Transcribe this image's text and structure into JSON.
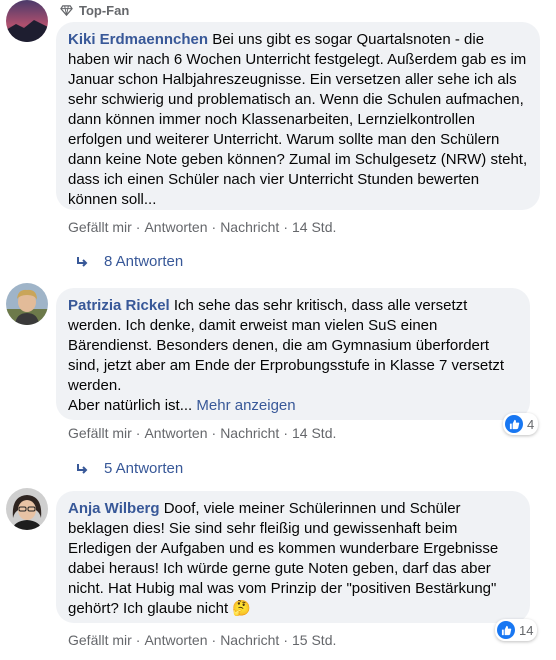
{
  "comments": [
    {
      "badge": "Top-Fan",
      "author": "Kiki Erdmaennchen",
      "text": " Bei uns gibt es sogar Quartalsnoten - die haben wir nach 6 Wochen Unterricht festgelegt. Außerdem gab es im Januar schon Halbjahreszeugnisse. Ein versetzen aller sehe ich als sehr schwierig und problematisch an. Wenn die Schulen aufmachen, dann können immer noch Klassenarbeiten, Lernzielkontrollen erfolgen und weiterer Unterricht. Warum sollte man den Schülern dann keine Note geben können? Zumal im Schulgesetz (NRW) steht, dass ich einen Schüler nach vier Unterricht Stunden bewerten können soll...",
      "actions": {
        "like": "Gefällt mir",
        "reply": "Antworten",
        "message": "Nachricht",
        "time": "14 Std."
      },
      "replies": "8 Antworten"
    },
    {
      "author": "Patrizia Rickel",
      "text": " Ich sehe das sehr kritisch, dass alle versetzt werden. Ich denke, damit erweist man vielen SuS einen Bärendienst. Besonders denen, die am Gymnasium überfordert sind, jetzt aber am Ende der Erprobungsstufe in Klasse 7 versetzt werden.",
      "text2": "Aber natürlich ist...",
      "more": "Mehr anzeigen",
      "reaction_count": "4",
      "actions": {
        "like": "Gefällt mir",
        "reply": "Antworten",
        "message": "Nachricht",
        "time": "14 Std."
      },
      "replies": "5 Antworten"
    },
    {
      "author": "Anja Wilberg",
      "text": " Doof, viele meiner Schülerinnen und Schüler beklagen dies! Sie sind sehr fleißig und gewissenhaft beim Erledigen der Aufgaben und es kommen wunderbare Ergebnisse dabei heraus! Ich würde gerne gute Noten geben, darf das aber nicht. Hat Hubig mal was vom Prinzip der \"positiven Bestärkung\" gehört? Ich glaube nicht ",
      "emoji": "🤔",
      "reaction_count": "14",
      "actions": {
        "like": "Gefällt mir",
        "reply": "Antworten",
        "message": "Nachricht",
        "time": "15 Std."
      }
    }
  ],
  "colors": {
    "link": "#385898",
    "bubble": "#f0f2f5",
    "meta": "#65676b",
    "like": "#1877f2"
  }
}
